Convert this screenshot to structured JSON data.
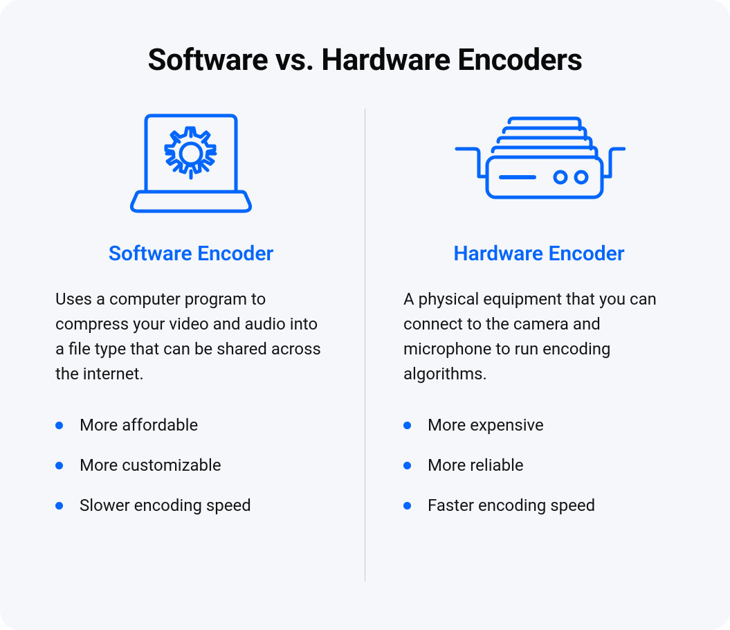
{
  "title": "Software vs. Hardware Encoders",
  "colors": {
    "accent": "#0066ff",
    "text": "#141414",
    "heading": "#0a0a0a",
    "background": "#f5f7fb"
  },
  "columns": {
    "left": {
      "icon": "laptop-gear-icon",
      "heading": "Software Encoder",
      "description": "Uses a computer program to compress your video and audio into a file type that can be shared across the internet.",
      "bullets": [
        "More affordable",
        "More customizable",
        "Slower encoding speed"
      ]
    },
    "right": {
      "icon": "hardware-device-icon",
      "heading": "Hardware Encoder",
      "description": "A physical equipment that you can connect to the camera and microphone to run encoding algorithms.",
      "bullets": [
        "More expensive",
        "More reliable",
        "Faster encoding speed"
      ]
    }
  }
}
